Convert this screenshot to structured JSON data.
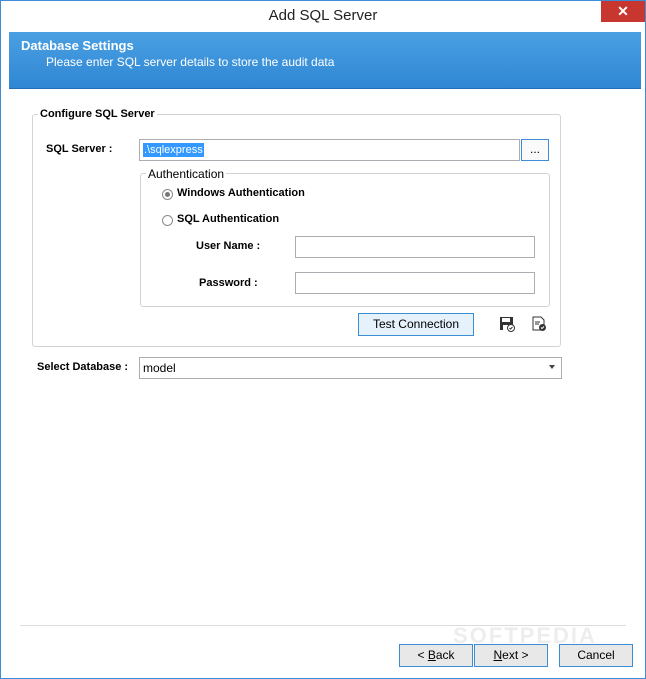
{
  "window": {
    "title": "Add SQL Server",
    "close_glyph": "✕"
  },
  "header": {
    "title": "Database Settings",
    "subtitle": "Please enter SQL server details to store the audit data"
  },
  "configure": {
    "legend": "Configure SQL Server",
    "server_label": "SQL Server  :",
    "server_value": ".\\sqlexpress",
    "browse_label": "...",
    "auth": {
      "legend": "Authentication",
      "windows_label": "Windows Authentication",
      "sql_label": "SQL Authentication",
      "selected": "Windows Authentication",
      "username_label": "User Name :",
      "username_value": "",
      "password_label": "Password   :",
      "password_value": ""
    },
    "test_connection_label": "Test Connection",
    "save_icon": "save-icon",
    "verify_icon": "verify-document-icon"
  },
  "database": {
    "label": "Select Database  :",
    "value": "model"
  },
  "footer": {
    "back_mnemonic": "B",
    "back_rest": "ack",
    "back_prefix": "< ",
    "next_mnemonic": "N",
    "next_rest": "ext >",
    "cancel_label": "Cancel"
  },
  "watermark": "SOFTPEDIA"
}
